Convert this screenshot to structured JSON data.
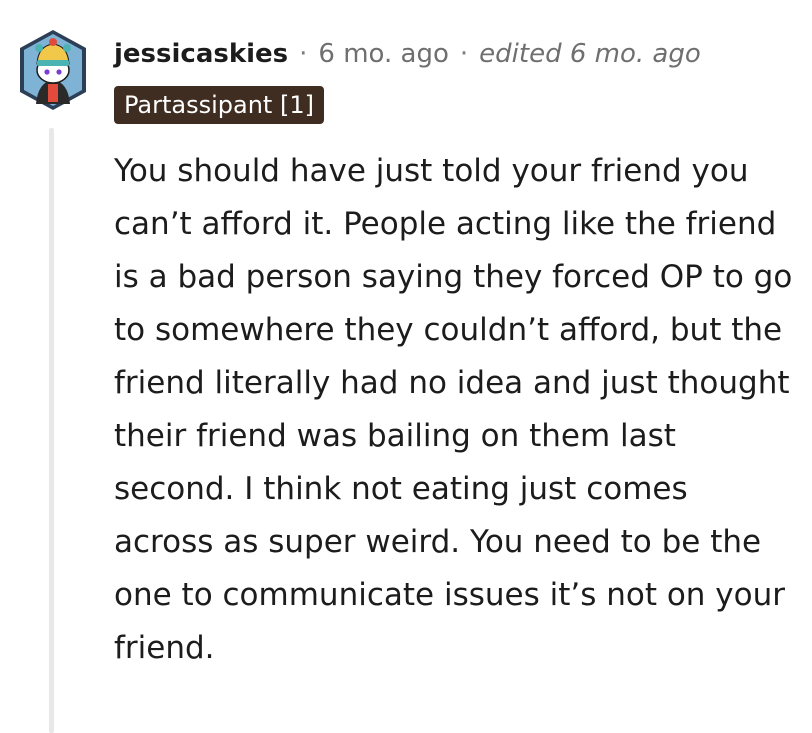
{
  "comment": {
    "username": "jessicaskies",
    "separator": "·",
    "timestamp": "6 mo. ago",
    "edited": "edited 6 mo. ago",
    "flair": "Partassipant [1]",
    "body": "You should have just told your friend you can’t afford it. People acting like the friend is a bad person saying they forced OP to go to somewhere they couldn’t afford, but the friend literally had no idea and just thought their friend was bailing on them last second. I think not eating just comes across as super weird. You need to be the one to communicate issues it’s not on your friend."
  },
  "colors": {
    "flair_bg": "#3f2d22",
    "thread_line": "#e6e8ea",
    "avatar_bg": "#7eb3d6",
    "avatar_hat": "#f2c84b"
  },
  "icons": {
    "avatar": "snoo-avatar-icon"
  }
}
